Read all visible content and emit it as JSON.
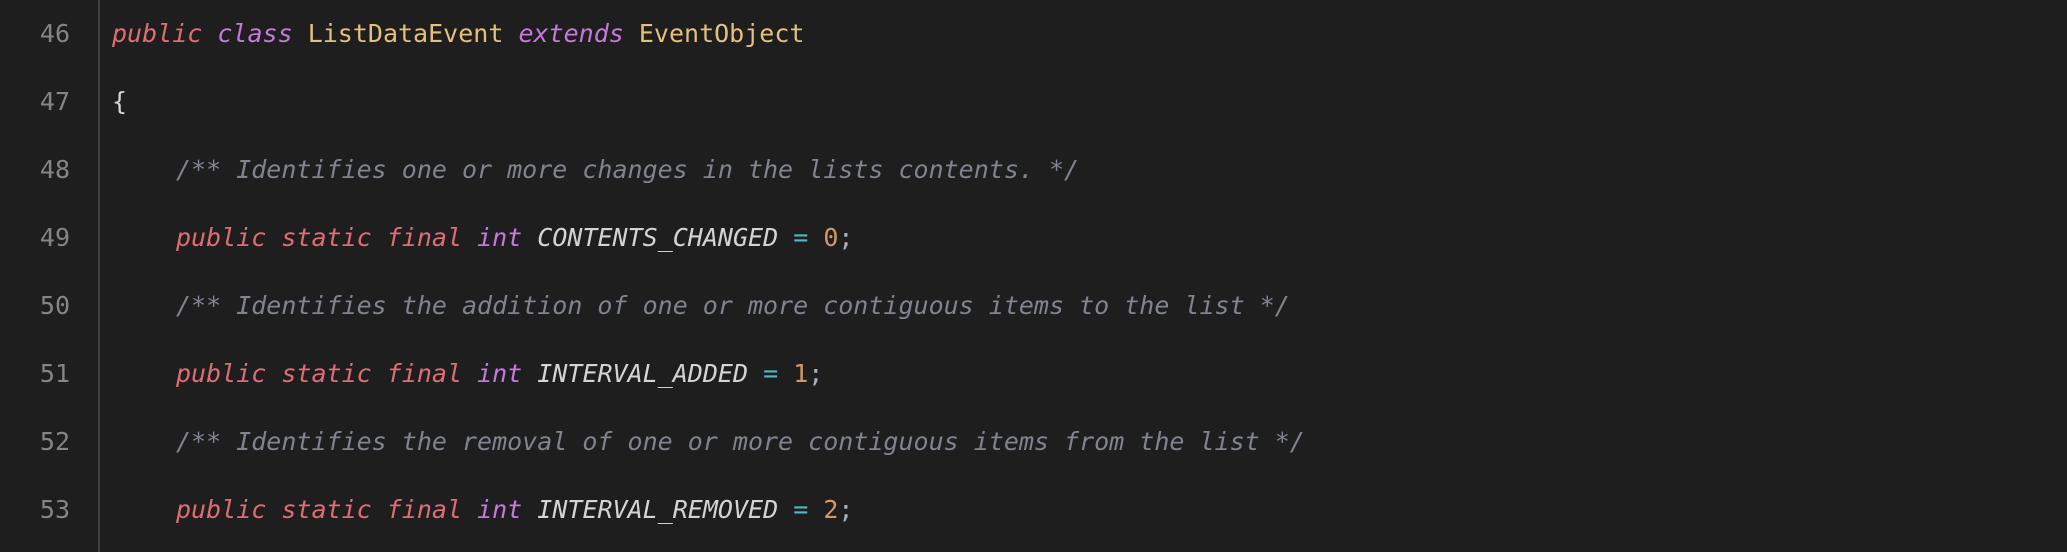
{
  "lines": {
    "46": {
      "number": "46",
      "tokens": {
        "public": "public",
        "class": "class",
        "className": "ListDataEvent",
        "extends": "extends",
        "superClass": "EventObject"
      }
    },
    "47": {
      "number": "47",
      "brace": "{"
    },
    "48": {
      "number": "48",
      "comment": "/** Identifies one or more changes in the lists contents. */"
    },
    "49": {
      "number": "49",
      "tokens": {
        "public": "public",
        "static": "static",
        "final": "final",
        "type": "int",
        "name": "CONTENTS_CHANGED",
        "eq": "=",
        "value": "0",
        "semi": ";"
      }
    },
    "50": {
      "number": "50",
      "comment": "/** Identifies the addition of one or more contiguous items to the list */"
    },
    "51": {
      "number": "51",
      "tokens": {
        "public": "public",
        "static": "static",
        "final": "final",
        "type": "int",
        "name": "INTERVAL_ADDED",
        "eq": "=",
        "value": "1",
        "semi": ";"
      }
    },
    "52": {
      "number": "52",
      "comment": "/** Identifies the removal of one or more contiguous items from the list */"
    },
    "53": {
      "number": "53",
      "tokens": {
        "public": "public",
        "static": "static",
        "final": "final",
        "type": "int",
        "name": "INTERVAL_REMOVED",
        "eq": "=",
        "value": "2",
        "semi": ";"
      }
    }
  }
}
